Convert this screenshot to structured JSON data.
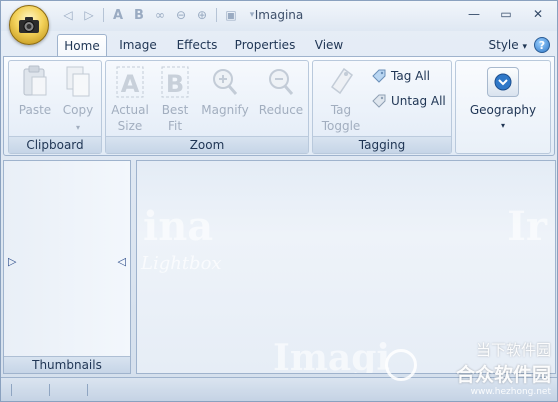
{
  "window": {
    "title": "Imagina"
  },
  "qat": {
    "items": [
      "back-icon",
      "forward-icon",
      "actual-size-icon",
      "best-fit-icon",
      "link-icon",
      "prev-icon",
      "next-icon",
      "save-icon",
      "customize-icon"
    ]
  },
  "tabs": [
    {
      "label": "Home",
      "active": true
    },
    {
      "label": "Image"
    },
    {
      "label": "Effects"
    },
    {
      "label": "Properties"
    },
    {
      "label": "View"
    }
  ],
  "style_menu": "Style",
  "help": "?",
  "ribbon": {
    "clipboard": {
      "label": "Clipboard",
      "paste": "Paste",
      "copy": "Copy"
    },
    "zoom": {
      "label": "Zoom",
      "actual_size_1": "Actual",
      "actual_size_2": "Size",
      "best_fit_1": "Best",
      "best_fit_2": "Fit",
      "magnify": "Magnify",
      "reduce": "Reduce"
    },
    "tagging": {
      "label": "Tagging",
      "tag_toggle_1": "Tag",
      "tag_toggle_2": "Toggle",
      "tag_all": "Tag All",
      "untag_all": "Untag All"
    },
    "geography": {
      "label": "Geography"
    }
  },
  "left_panel": {
    "label": "Thumbnails"
  },
  "main_panel": {
    "wm_a": "ina",
    "wm_b": "Lightbox",
    "wm_c": "Imagi",
    "wm_d": "Ir"
  },
  "site_watermark": {
    "line1": "当下软件园",
    "line2": "合众软件园",
    "url": "www.hezhong.net"
  },
  "colors": {
    "accent": "#2f78c8",
    "ribbon_text": "#1f3554",
    "disabled_text": "#a2aebf"
  }
}
